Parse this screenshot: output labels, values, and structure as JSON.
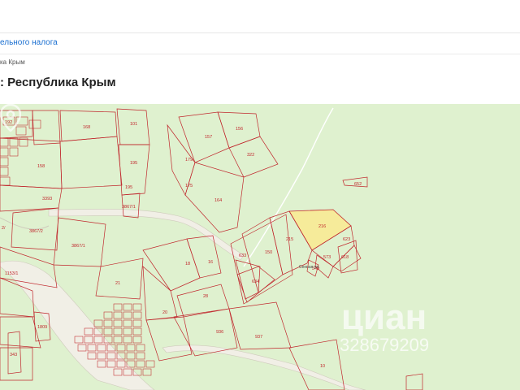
{
  "header": {
    "link_text": "ельного налога",
    "breadcrumb": "ка Крым",
    "title": ": Республика Крым"
  },
  "map": {
    "plot_labels": [
      "192",
      "168",
      "101",
      "156",
      "157",
      "322",
      "179",
      "175",
      "195",
      "164",
      "3393",
      "158",
      "195",
      "3867/1",
      "3867/2",
      "3867/1",
      "2/",
      "215",
      "216",
      "150",
      "633",
      "634",
      "652",
      "623",
      "573",
      "549",
      "618",
      "18",
      "16",
      "21",
      "28",
      "20",
      "936",
      "937",
      "1153/1",
      "1809",
      "10",
      "343"
    ],
    "street_label": "Сенная ул.",
    "watermark_brand": "циан",
    "watermark_number": "328679209",
    "colors": {
      "land": "#dff1cf",
      "boundary": "#c0272d",
      "highlight": "#f6eb9a",
      "road": "#f1efe6"
    }
  }
}
